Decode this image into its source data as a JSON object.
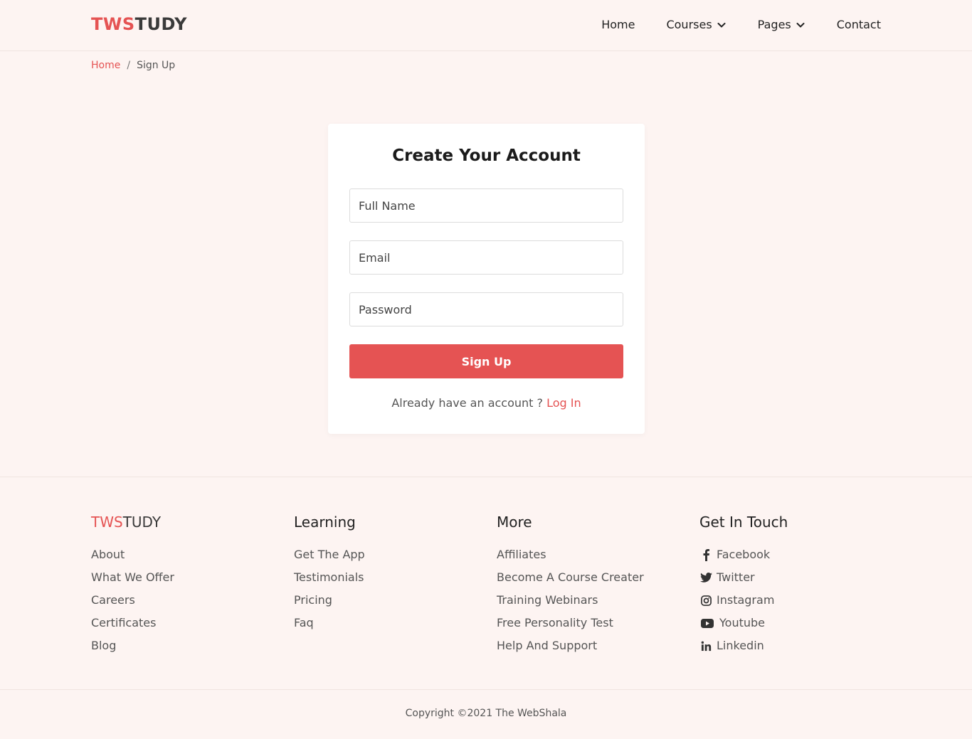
{
  "brand": {
    "part1": "TWS",
    "part2": "TUDY"
  },
  "colors": {
    "accent": "#e55353",
    "background": "#fdf4f2",
    "text_dark": "#222222"
  },
  "nav": {
    "home": "Home",
    "courses": "Courses",
    "pages": "Pages",
    "contact": "Contact"
  },
  "breadcrumb": {
    "home": "Home",
    "separator": "/",
    "current": "Sign Up"
  },
  "form": {
    "title": "Create Your Account",
    "full_name_placeholder": "Full Name",
    "email_placeholder": "Email",
    "password_placeholder": "Password",
    "submit_label": "Sign Up",
    "login_prompt": "Already have an account ?",
    "login_link": "Log In"
  },
  "footer": {
    "col1": {
      "items": [
        "About",
        "What We Offer",
        "Careers",
        "Certificates",
        "Blog"
      ]
    },
    "col2": {
      "heading": "Learning",
      "items": [
        "Get The App",
        "Testimonials",
        "Pricing",
        "Faq"
      ]
    },
    "col3": {
      "heading": "More",
      "items": [
        "Affiliates",
        "Become A Course Creater",
        "Training Webinars",
        "Free Personality Test",
        "Help And Support"
      ]
    },
    "col4": {
      "heading": "Get In Touch",
      "items": [
        {
          "label": "Facebook",
          "icon": "facebook-icon"
        },
        {
          "label": "Twitter",
          "icon": "twitter-icon"
        },
        {
          "label": "Instagram",
          "icon": "instagram-icon"
        },
        {
          "label": "Youtube",
          "icon": "youtube-icon"
        },
        {
          "label": "Linkedin",
          "icon": "linkedin-icon"
        }
      ]
    },
    "copyright": "Copyright ©2021 The WebShala"
  }
}
